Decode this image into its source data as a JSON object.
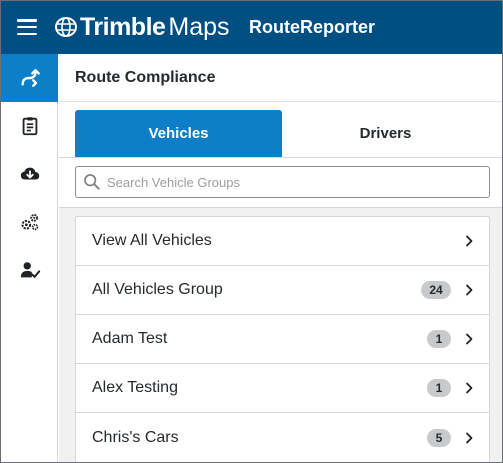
{
  "header": {
    "brand": "Trimble",
    "product": "Maps",
    "app_name": "RouteReporter",
    "colors": {
      "bar": "#004f83",
      "accent": "#0d7fc8"
    }
  },
  "sidebar": {
    "items": [
      {
        "icon": "route-icon",
        "active": true
      },
      {
        "icon": "clipboard-icon",
        "active": false
      },
      {
        "icon": "cloud-download-icon",
        "active": false
      },
      {
        "icon": "gears-icon",
        "active": false
      },
      {
        "icon": "user-check-icon",
        "active": false
      }
    ]
  },
  "main": {
    "title": "Route Compliance",
    "tabs": [
      {
        "label": "Vehicles",
        "active": true
      },
      {
        "label": "Drivers",
        "active": false
      }
    ],
    "search": {
      "placeholder": "Search Vehicle Groups",
      "value": ""
    },
    "groups": [
      {
        "label": "View All Vehicles",
        "count": null
      },
      {
        "label": "All Vehicles Group",
        "count": "24"
      },
      {
        "label": "Adam Test",
        "count": "1"
      },
      {
        "label": "Alex Testing",
        "count": "1"
      },
      {
        "label": "Chris's Cars",
        "count": "5"
      }
    ]
  }
}
